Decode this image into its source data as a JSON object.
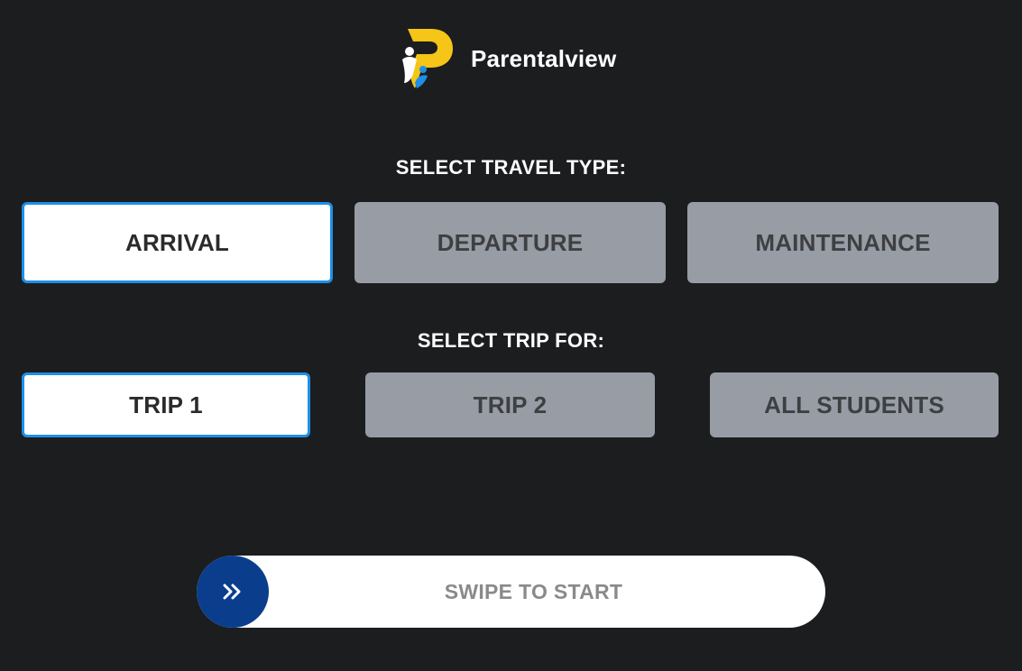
{
  "app": {
    "brand_name": "Parentalview",
    "colors": {
      "background": "#1c1d1f",
      "selected_border": "#1e8fe8",
      "unselected_fill": "#979ca5",
      "handle": "#0a3e8c",
      "logo_yellow": "#f5c518",
      "logo_blue": "#1e8fe8"
    },
    "logo_icon": "parentalview-logo-icon"
  },
  "travel_type": {
    "title": "SELECT TRAVEL TYPE:",
    "options": [
      {
        "label": "ARRIVAL",
        "selected": true
      },
      {
        "label": "DEPARTURE",
        "selected": false
      },
      {
        "label": "MAINTENANCE",
        "selected": false
      }
    ]
  },
  "trip_for": {
    "title": "SELECT TRIP FOR:",
    "options": [
      {
        "label": "TRIP 1",
        "selected": true
      },
      {
        "label": "TRIP 2",
        "selected": false
      },
      {
        "label": "ALL STUDENTS",
        "selected": false
      }
    ]
  },
  "swipe": {
    "label": "SWIPE TO START",
    "handle_icon": "double-chevron-right-icon"
  }
}
